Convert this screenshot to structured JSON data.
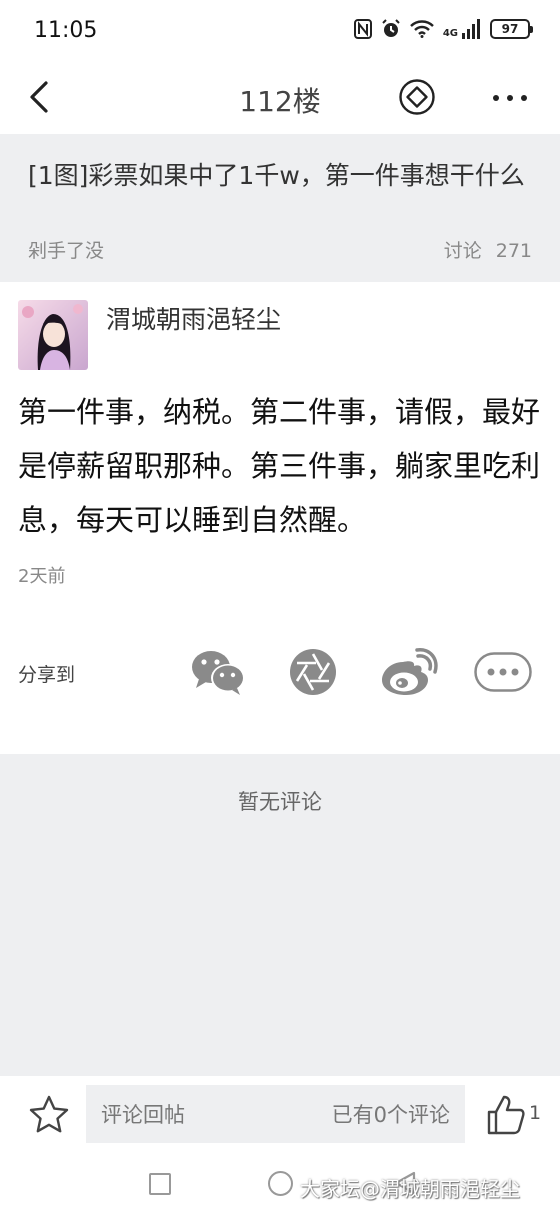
{
  "status_bar": {
    "time": "11:05",
    "network": "4G",
    "battery": "97",
    "icons": [
      "nfc-icon",
      "alarm-icon",
      "wifi-icon",
      "signal-icon",
      "battery-icon"
    ]
  },
  "nav": {
    "title": "112楼",
    "icons": [
      "back-icon",
      "diamond-icon",
      "more-icon"
    ]
  },
  "thread": {
    "title": "[1图]彩票如果中了1千w，第一件事想干什么",
    "forum": "剁手了没",
    "stats_label": "讨论",
    "stats_count": "271"
  },
  "post": {
    "author": "渭城朝雨浥轻尘",
    "content": "第一件事，纳税。第二件事，请假，最好是停薪留职那种。第三件事，躺家里吃利息，每天可以睡到自然醒。",
    "time": "2天前"
  },
  "share": {
    "label": "分享到",
    "targets": [
      "wechat-icon",
      "moments-icon",
      "weibo-icon",
      "more-share-icon"
    ]
  },
  "comments": {
    "empty_text": "暂无评论"
  },
  "bottom_bar": {
    "input_placeholder": "评论回帖",
    "comment_count": "已有0个评论",
    "like_count": "1"
  },
  "watermark": "大家坛@渭城朝雨浥轻尘",
  "colors": {
    "section_bg": "#eeeff1",
    "icon_gray": "#8a8a8a",
    "text_primary": "#111111",
    "text_secondary": "#888888"
  }
}
